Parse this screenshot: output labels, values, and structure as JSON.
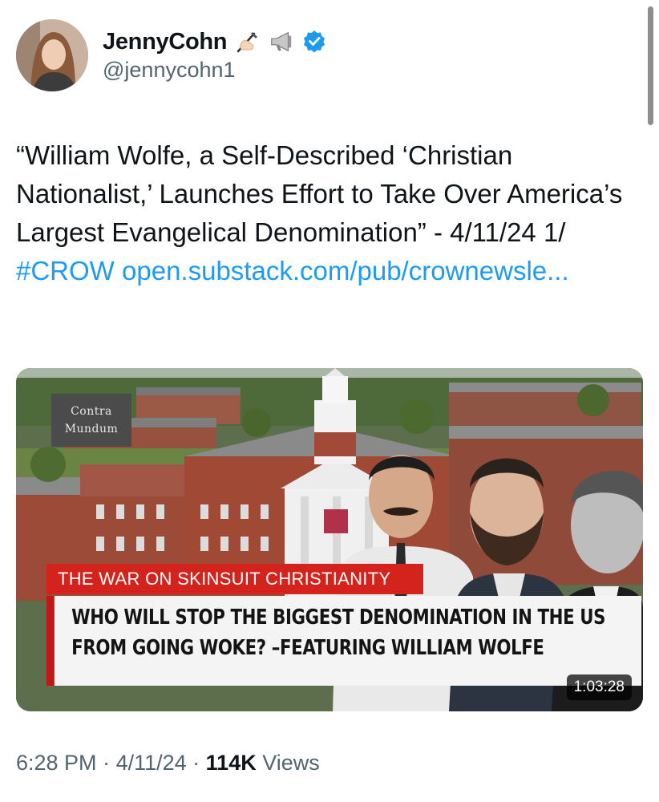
{
  "author": {
    "display_name": "JennyCohn",
    "handle": "@jennycohn1",
    "badges": [
      "writing-hand-emoji",
      "megaphone-emoji",
      "verified-badge-icon"
    ],
    "verified_color": "#1d9bf0"
  },
  "tweet": {
    "text": "“William Wolfe, a Self-Described ‘Christian Nationalist,’ Launches Effort to Take Over America’s Largest Evangelical Denomination” - 4/11/24 1/ ",
    "hashtag": "#CROW",
    "link": " open.substack.com/pub/crownewsle...",
    "link_color": "#1d9bf0"
  },
  "media": {
    "watermark_line1": "Contra",
    "watermark_line2": "Mundum",
    "banner_red": "THE WAR ON SKINSUIT CHRISTIANITY",
    "banner_white_line1": "WHO WILL STOP THE BIGGEST DENOMINATION IN THE US",
    "banner_white_line2": "FROM GOING WOKE? –FEATURING WILLIAM WOLFE",
    "duration": "1:03:28"
  },
  "meta": {
    "time": "6:28 PM",
    "sep1": " · ",
    "date": "4/11/24",
    "sep2": " · ",
    "views_count": "114K",
    "views_label": " Views"
  }
}
